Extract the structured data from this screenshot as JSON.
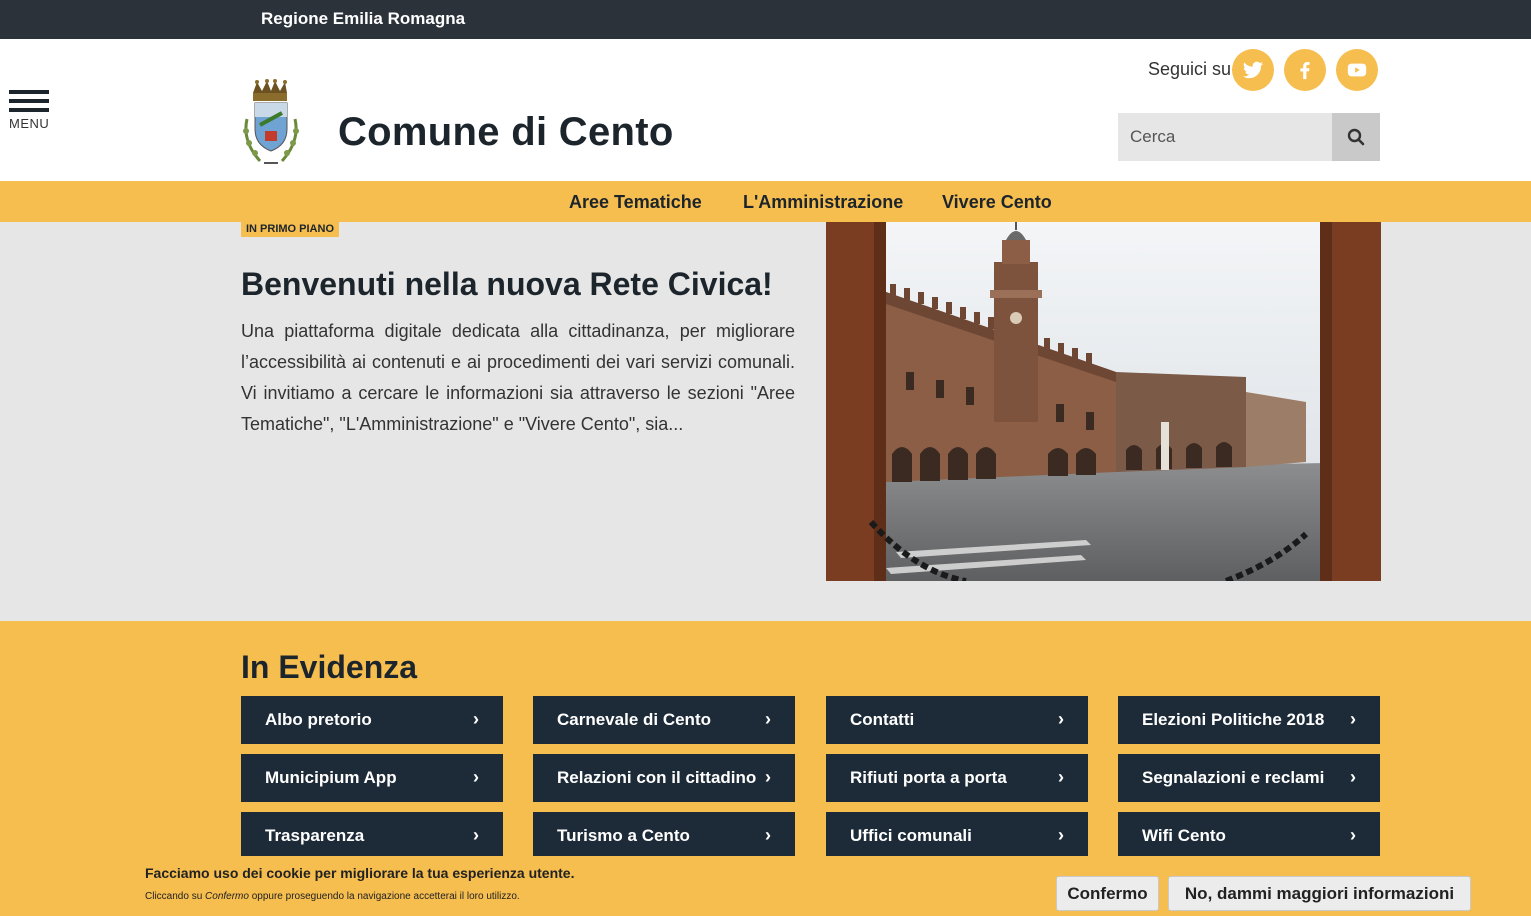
{
  "topbar": {
    "region": "Regione Emilia Romagna"
  },
  "header": {
    "menu_label": "MENU",
    "site_title": "Comune di Cento",
    "follow_label": "Seguici su",
    "social": [
      "twitter-icon",
      "facebook-icon",
      "youtube-icon"
    ],
    "search_placeholder": "Cerca"
  },
  "nav": {
    "items": [
      "Aree Tematiche",
      "L'Amministrazione",
      "Vivere Cento"
    ]
  },
  "hero": {
    "badge": "IN PRIMO PIANO",
    "title": "Benvenuti nella nuova Rete Civica!",
    "text": "Una piattaforma digitale dedicata alla cittadinanza, per migliorare l’accessibilità ai contenuti e ai procedimenti dei vari servizi comunali. Vi invitiamo a cercare le informazioni sia attraverso le sezioni \"Aree Tematiche\", \"L'Amministrazione\" e \"Vivere Cento\", sia..."
  },
  "evidenza": {
    "title": "In Evidenza",
    "tiles": [
      "Albo pretorio",
      "Carnevale di Cento",
      "Contatti",
      "Elezioni Politiche 2018",
      "Municipium App",
      "Relazioni con il cittadino",
      "Rifiuti porta a porta",
      "Segnalazioni e reclami",
      "Trasparenza",
      "Turismo a Cento",
      "Uffici comunali",
      "Wifi Cento"
    ]
  },
  "cookie": {
    "line1": "Facciamo uso dei cookie per migliorare la tua esperienza utente.",
    "line2_pre": "Cliccando su ",
    "line2_em": "Confermo",
    "line2_post": " oppure proseguendo la navigazione accetterai il loro utilizzo.",
    "confirm": "Confermo",
    "more": "No, dammi maggiori informazioni"
  },
  "colors": {
    "accent": "#f6bd4f",
    "dark": "#1d2b38",
    "topbar": "#2b323a",
    "hero_bg": "#e6e6e6"
  }
}
